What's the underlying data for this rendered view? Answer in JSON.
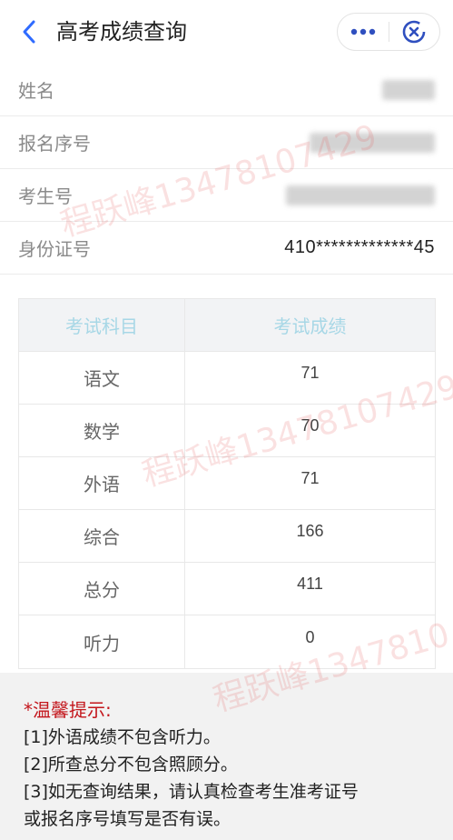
{
  "header": {
    "title": "高考成绩查询",
    "back_icon": "chevron-left-icon",
    "more_icon": "more-dots-icon",
    "close_icon": "close-target-icon"
  },
  "info": {
    "name": {
      "label": "姓名",
      "value": ""
    },
    "reg_no": {
      "label": "报名序号",
      "value": ""
    },
    "exam_no": {
      "label": "考生号",
      "value": ""
    },
    "id_no": {
      "label": "身份证号",
      "value": "410*************45"
    }
  },
  "table": {
    "headers": [
      "考试科目",
      "考试成绩"
    ],
    "rows": [
      {
        "subject": "语文",
        "score": "71"
      },
      {
        "subject": "数学",
        "score": "70"
      },
      {
        "subject": "外语",
        "score": "71"
      },
      {
        "subject": "综合",
        "score": "166"
      },
      {
        "subject": "总分",
        "score": "411"
      },
      {
        "subject": "听力",
        "score": "0"
      }
    ]
  },
  "notes": {
    "title": "*温馨提示:",
    "items": [
      "[1]外语成绩不包含听力。",
      "[2]所查总分不包含照顾分。",
      "[3]如无查询结果，请认真检查考生准考证号",
      "或报名序号填写是否有误。"
    ]
  },
  "watermark": "程跃峰13478107429",
  "colors": {
    "accent_blue": "#2f6bff",
    "header_text": "#a7d7e6",
    "notes_red": "#c3161c"
  }
}
